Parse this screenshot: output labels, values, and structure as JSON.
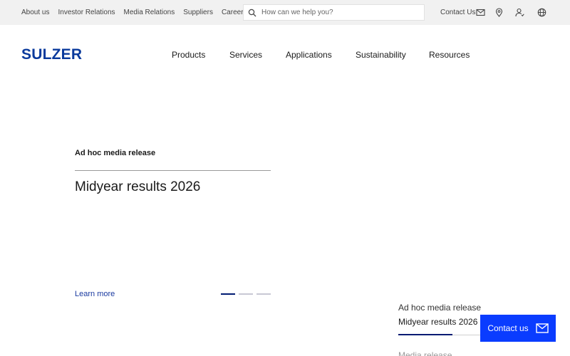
{
  "topbar": {
    "links": [
      "About us",
      "Investor Relations",
      "Media Relations",
      "Suppliers",
      "Careers"
    ],
    "search_placeholder": "How can we help you?",
    "contact_label": "Contact Us",
    "icons": [
      "mail-icon",
      "location-pin-icon",
      "user-icon",
      "globe-icon"
    ]
  },
  "brand": {
    "logo_text": "SULZER",
    "color": "#0a3a9c"
  },
  "nav": {
    "items": [
      "Products",
      "Services",
      "Applications",
      "Sustainability",
      "Resources"
    ]
  },
  "hero": {
    "eyebrow": "Ad hoc media release",
    "title": "Midyear results 2026",
    "link": "Learn more",
    "slides_total": 3,
    "slide_active": 1
  },
  "news": {
    "items": [
      {
        "tag": "Ad hoc media release",
        "title": "Midyear results 2026"
      },
      {
        "tag": "Media release",
        "title": ""
      }
    ]
  },
  "contact_fab": {
    "label": "Contact us",
    "color": "#0a3cff"
  }
}
